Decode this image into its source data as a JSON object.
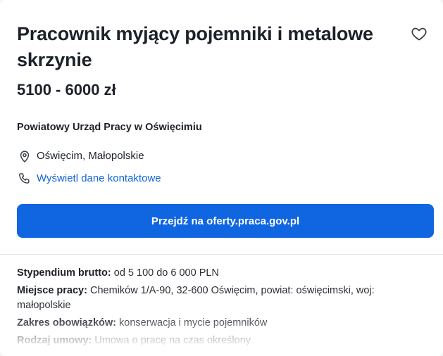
{
  "offer": {
    "title": "Pracownik myjący pojemniki i metalowe skrzynie",
    "salary": "5100 - 6000 zł",
    "employer": "Powiatowy Urząd Pracy w Oświęcimiu",
    "location": "Oświęcim, Małopolskie",
    "contact_link": "Wyświetl dane kontaktowe",
    "cta_label": "Przejdź na oferty.praca.gov.pl"
  },
  "details": [
    {
      "label": "Stypendium brutto:",
      "value": "od 5 100 do 6 000 PLN"
    },
    {
      "label": "Miejsce pracy:",
      "value": "Chemików 1/A-90, 32-600 Oświęcim, powiat: oświęcimski, woj: małopolskie"
    },
    {
      "label": "Zakres obowiązków:",
      "value": "konserwacja i mycie pojemników"
    },
    {
      "label": "Rodzaj umowy:",
      "value": "Umowa o pracę na czas określony"
    }
  ],
  "icons": {
    "favorite": "heart-outline-icon",
    "location": "map-pin-icon",
    "contact": "phone-icon"
  },
  "colors": {
    "accent": "#0f66e0",
    "link": "#1266d6",
    "text": "#1d2129"
  }
}
